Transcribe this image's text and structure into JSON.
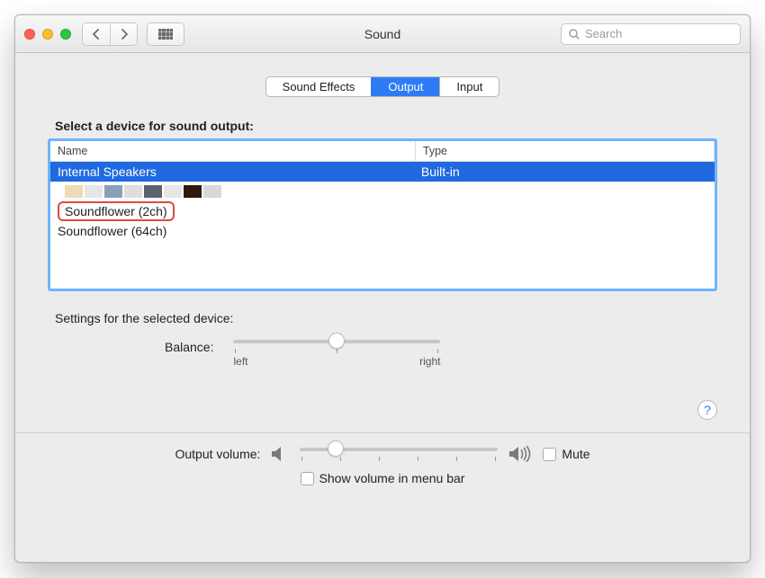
{
  "window": {
    "title": "Sound",
    "search_placeholder": "Search"
  },
  "tabs": [
    {
      "label": "Sound Effects",
      "active": false
    },
    {
      "label": "Output",
      "active": true
    },
    {
      "label": "Input",
      "active": false
    }
  ],
  "device_list": {
    "heading": "Select a device for sound output:",
    "columns": {
      "name": "Name",
      "type": "Type"
    },
    "rows": [
      {
        "name": "Internal Speakers",
        "type": "Built-in",
        "selected": true
      },
      {
        "name": "",
        "type": "",
        "obscured": true
      },
      {
        "name": "Soundflower (2ch)",
        "type": "",
        "highlighted": true
      },
      {
        "name": "Soundflower (64ch)",
        "type": ""
      }
    ]
  },
  "settings": {
    "heading": "Settings for the selected device:",
    "balance": {
      "label": "Balance:",
      "left": "left",
      "right": "right",
      "value": 0.5
    }
  },
  "output_volume": {
    "label": "Output volume:",
    "value": 0.18,
    "mute_label": "Mute",
    "mute_checked": false,
    "show_menu_label": "Show volume in menu bar",
    "show_menu_checked": false
  },
  "colors": {
    "accent": "#2f7bf6",
    "selection": "#2069e0",
    "focus_ring": "#6fb3ff",
    "highlight_ring": "#e0483f"
  }
}
